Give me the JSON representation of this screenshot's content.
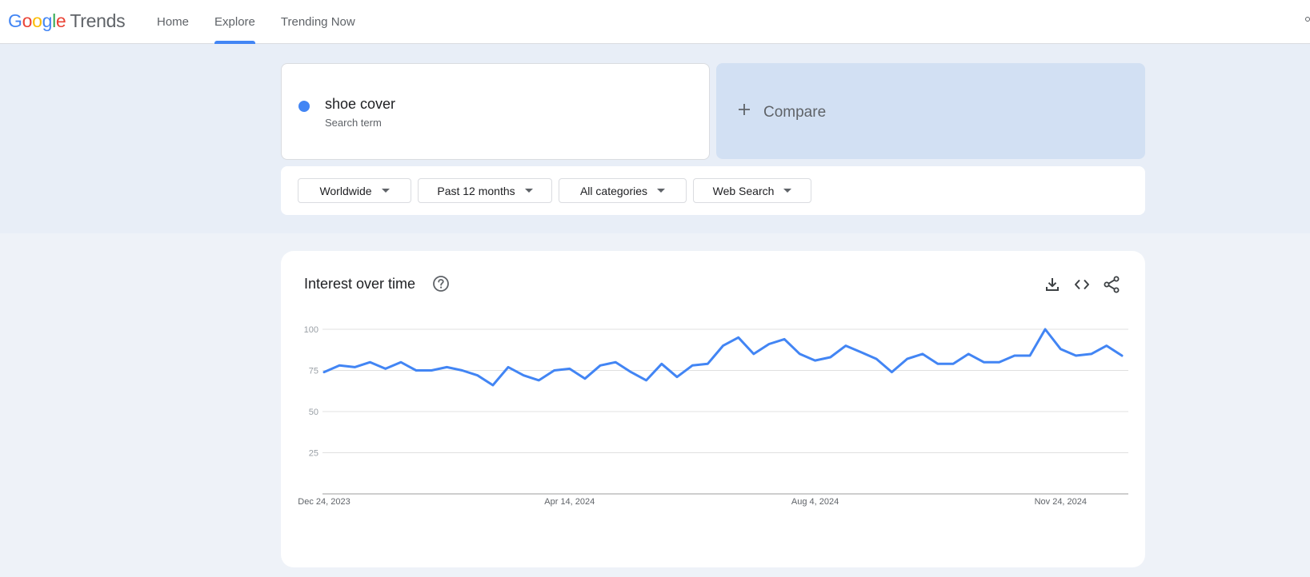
{
  "header": {
    "logo": {
      "brand": [
        "G",
        "o",
        "o",
        "g",
        "l",
        "e"
      ],
      "product": "Trends"
    },
    "nav": [
      {
        "label": "Home",
        "active": false
      },
      {
        "label": "Explore",
        "active": true
      },
      {
        "label": "Trending Now",
        "active": false
      }
    ]
  },
  "term": {
    "name": "shoe cover",
    "type": "Search term",
    "color": "#4285f4"
  },
  "compare": {
    "label": "Compare"
  },
  "filters": [
    {
      "label": "Worldwide"
    },
    {
      "label": "Past 12 months"
    },
    {
      "label": "All categories"
    },
    {
      "label": "Web Search"
    }
  ],
  "interest": {
    "title": "Interest over time",
    "icons": [
      "help-icon",
      "download-icon",
      "embed-code-icon",
      "share-icon"
    ]
  },
  "chart_data": {
    "type": "line",
    "title": "Interest over time",
    "xlabel": "",
    "ylabel": "",
    "ylim": [
      0,
      100
    ],
    "yticks": [
      25,
      50,
      75,
      100
    ],
    "grid": true,
    "x_tick_labels": [
      "Dec 24, 2023",
      "Apr 14, 2024",
      "Aug 4, 2024",
      "Nov 24, 2024"
    ],
    "x_tick_weeks": [
      0,
      16,
      32,
      48
    ],
    "start_date": "Dec 24, 2023",
    "interval": "weekly",
    "series": [
      {
        "name": "shoe cover",
        "color": "#4285f4",
        "values": [
          74,
          78,
          77,
          80,
          76,
          80,
          75,
          75,
          77,
          75,
          72,
          66,
          77,
          72,
          69,
          75,
          76,
          70,
          78,
          80,
          74,
          69,
          79,
          71,
          78,
          79,
          90,
          95,
          85,
          91,
          94,
          85,
          81,
          83,
          90,
          86,
          82,
          74,
          82,
          85,
          79,
          79,
          85,
          80,
          80,
          84,
          84,
          100,
          88,
          84,
          85,
          90,
          84
        ]
      }
    ]
  }
}
